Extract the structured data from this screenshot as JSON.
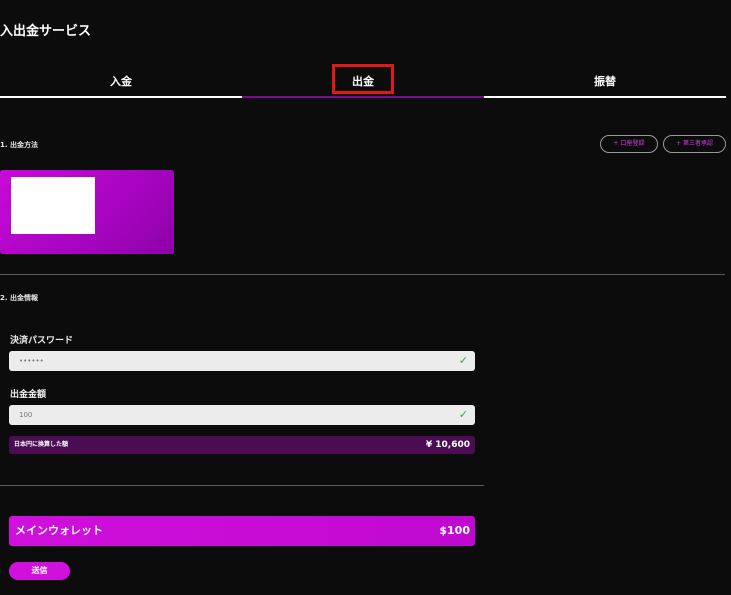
{
  "page_title": "入出金サービス",
  "tabs": [
    {
      "label": "入金",
      "active": false
    },
    {
      "label": "出金",
      "active": true
    },
    {
      "label": "振替",
      "active": false
    }
  ],
  "section1": {
    "label": "1. 出金方法",
    "account_register_button": "+ 口座登録",
    "third_party_button": "+ 第三者承認"
  },
  "section2": {
    "label": "2. 出金情報"
  },
  "password_field": {
    "label": "決済パスワード",
    "value": "••••••"
  },
  "amount_field": {
    "label": "出金金額",
    "value": "100"
  },
  "conversion": {
    "label": "日本円に換算した額",
    "value": "¥ 10,600"
  },
  "wallet": {
    "name": "メインウォレット",
    "amount": "$100"
  },
  "submit_label": "送信",
  "colors": {
    "accent": "#d010dc",
    "tab_active_line": "#7a0a92",
    "highlight_box": "#e01818",
    "check": "#2ea84a"
  }
}
